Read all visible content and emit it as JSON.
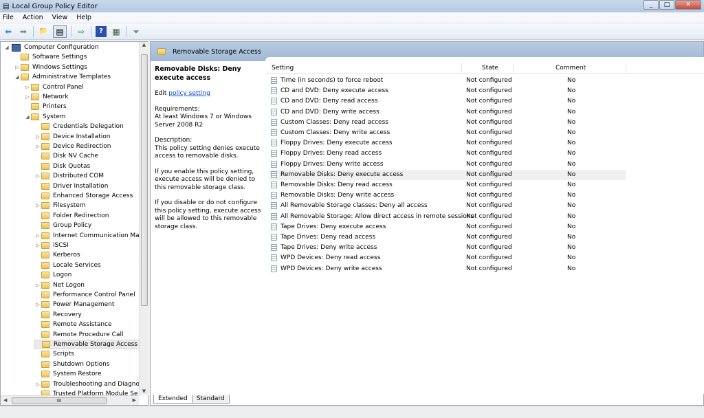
{
  "window": {
    "title": "Local Group Policy Editor",
    "minimize": "_",
    "maximize": "□",
    "close": "✕"
  },
  "menu": [
    "File",
    "Action",
    "View",
    "Help"
  ],
  "toolbar": [
    {
      "name": "back-icon",
      "glyph": "⬅"
    },
    {
      "name": "forward-icon",
      "glyph": "➡"
    },
    {
      "name": "up-folder-icon",
      "glyph": "📁"
    },
    {
      "name": "show-hide-tree-icon",
      "glyph": "▤"
    },
    {
      "name": "export-list-icon",
      "glyph": "⇨"
    },
    {
      "name": "help-icon",
      "glyph": "?"
    },
    {
      "name": "properties-icon",
      "glyph": "▦"
    },
    {
      "name": "filter-icon",
      "glyph": "⏷"
    }
  ],
  "tree": [
    {
      "label": "Computer Configuration",
      "level": 0,
      "arrow": "◢",
      "icon": "computer"
    },
    {
      "label": "Software Settings",
      "level": 1,
      "arrow": ""
    },
    {
      "label": "Windows Settings",
      "level": 1,
      "arrow": "▷"
    },
    {
      "label": "Administrative Templates",
      "level": 1,
      "arrow": "◢"
    },
    {
      "label": "Control Panel",
      "level": 2,
      "arrow": "▷"
    },
    {
      "label": "Network",
      "level": 2,
      "arrow": "▷"
    },
    {
      "label": "Printers",
      "level": 2,
      "arrow": ""
    },
    {
      "label": "System",
      "level": 2,
      "arrow": "◢"
    },
    {
      "label": "Credentials Delegation",
      "level": 3,
      "arrow": ""
    },
    {
      "label": "Device Installation",
      "level": 3,
      "arrow": "▷"
    },
    {
      "label": "Device Redirection",
      "level": 3,
      "arrow": "▷"
    },
    {
      "label": "Disk NV Cache",
      "level": 3,
      "arrow": ""
    },
    {
      "label": "Disk Quotas",
      "level": 3,
      "arrow": ""
    },
    {
      "label": "Distributed COM",
      "level": 3,
      "arrow": "▷"
    },
    {
      "label": "Driver Installation",
      "level": 3,
      "arrow": ""
    },
    {
      "label": "Enhanced Storage Access",
      "level": 3,
      "arrow": ""
    },
    {
      "label": "Filesystem",
      "level": 3,
      "arrow": "▷"
    },
    {
      "label": "Folder Redirection",
      "level": 3,
      "arrow": ""
    },
    {
      "label": "Group Policy",
      "level": 3,
      "arrow": ""
    },
    {
      "label": "Internet Communication Ma",
      "level": 3,
      "arrow": "▷"
    },
    {
      "label": "iSCSI",
      "level": 3,
      "arrow": "▷"
    },
    {
      "label": "Kerberos",
      "level": 3,
      "arrow": ""
    },
    {
      "label": "Locale Services",
      "level": 3,
      "arrow": ""
    },
    {
      "label": "Logon",
      "level": 3,
      "arrow": ""
    },
    {
      "label": "Net Logon",
      "level": 3,
      "arrow": "▷"
    },
    {
      "label": "Performance Control Panel",
      "level": 3,
      "arrow": ""
    },
    {
      "label": "Power Management",
      "level": 3,
      "arrow": "▷"
    },
    {
      "label": "Recovery",
      "level": 3,
      "arrow": ""
    },
    {
      "label": "Remote Assistance",
      "level": 3,
      "arrow": ""
    },
    {
      "label": "Remote Procedure Call",
      "level": 3,
      "arrow": ""
    },
    {
      "label": "Removable Storage Access",
      "level": 3,
      "arrow": "",
      "selected": true
    },
    {
      "label": "Scripts",
      "level": 3,
      "arrow": ""
    },
    {
      "label": "Shutdown Options",
      "level": 3,
      "arrow": ""
    },
    {
      "label": "System Restore",
      "level": 3,
      "arrow": ""
    },
    {
      "label": "Troubleshooting and Diagno",
      "level": 3,
      "arrow": "▷"
    },
    {
      "label": "Trusted Platform Module Se",
      "level": 3,
      "arrow": ""
    }
  ],
  "header": {
    "title": "Removable Storage Access"
  },
  "description": {
    "title": "Removable Disks: Deny execute access",
    "edit_prefix": "Edit ",
    "edit_link": "policy setting",
    "requirements": "Requirements:\nAt least Windows 7 or Windows Server 2008 R2",
    "description": "Description:\nThis policy setting denies execute access to removable disks.",
    "enable": "If you enable this policy setting, execute access will be denied to this removable storage class.",
    "disable": "If you disable or do not configure this policy setting, execute access will be allowed to this removable storage class."
  },
  "columns": {
    "setting": "Setting",
    "state": "State",
    "comment": "Comment"
  },
  "rows": [
    {
      "setting": "Time (in seconds) to force reboot",
      "state": "Not configured",
      "comment": "No"
    },
    {
      "setting": "CD and DVD: Deny execute access",
      "state": "Not configured",
      "comment": "No"
    },
    {
      "setting": "CD and DVD: Deny read access",
      "state": "Not configured",
      "comment": "No"
    },
    {
      "setting": "CD and DVD: Deny write access",
      "state": "Not configured",
      "comment": "No"
    },
    {
      "setting": "Custom Classes: Deny read access",
      "state": "Not configured",
      "comment": "No"
    },
    {
      "setting": "Custom Classes: Deny write access",
      "state": "Not configured",
      "comment": "No"
    },
    {
      "setting": "Floppy Drives: Deny execute access",
      "state": "Not configured",
      "comment": "No"
    },
    {
      "setting": "Floppy Drives: Deny read access",
      "state": "Not configured",
      "comment": "No"
    },
    {
      "setting": "Floppy Drives: Deny write access",
      "state": "Not configured",
      "comment": "No"
    },
    {
      "setting": "Removable Disks: Deny execute access",
      "state": "Not configured",
      "comment": "No",
      "selected": true
    },
    {
      "setting": "Removable Disks: Deny read access",
      "state": "Not configured",
      "comment": "No"
    },
    {
      "setting": "Removable Disks: Deny write access",
      "state": "Not configured",
      "comment": "No"
    },
    {
      "setting": "All Removable Storage classes: Deny all access",
      "state": "Not configured",
      "comment": "No"
    },
    {
      "setting": "All Removable Storage: Allow direct access in remote sessions",
      "state": "Not configured",
      "comment": "No"
    },
    {
      "setting": "Tape Drives: Deny execute access",
      "state": "Not configured",
      "comment": "No"
    },
    {
      "setting": "Tape Drives: Deny read access",
      "state": "Not configured",
      "comment": "No"
    },
    {
      "setting": "Tape Drives: Deny write access",
      "state": "Not configured",
      "comment": "No"
    },
    {
      "setting": "WPD Devices: Deny read access",
      "state": "Not configured",
      "comment": "No"
    },
    {
      "setting": "WPD Devices: Deny write access",
      "state": "Not configured",
      "comment": "No"
    }
  ],
  "tabs": [
    "Extended",
    "Standard"
  ],
  "hscroll_grip": "III"
}
